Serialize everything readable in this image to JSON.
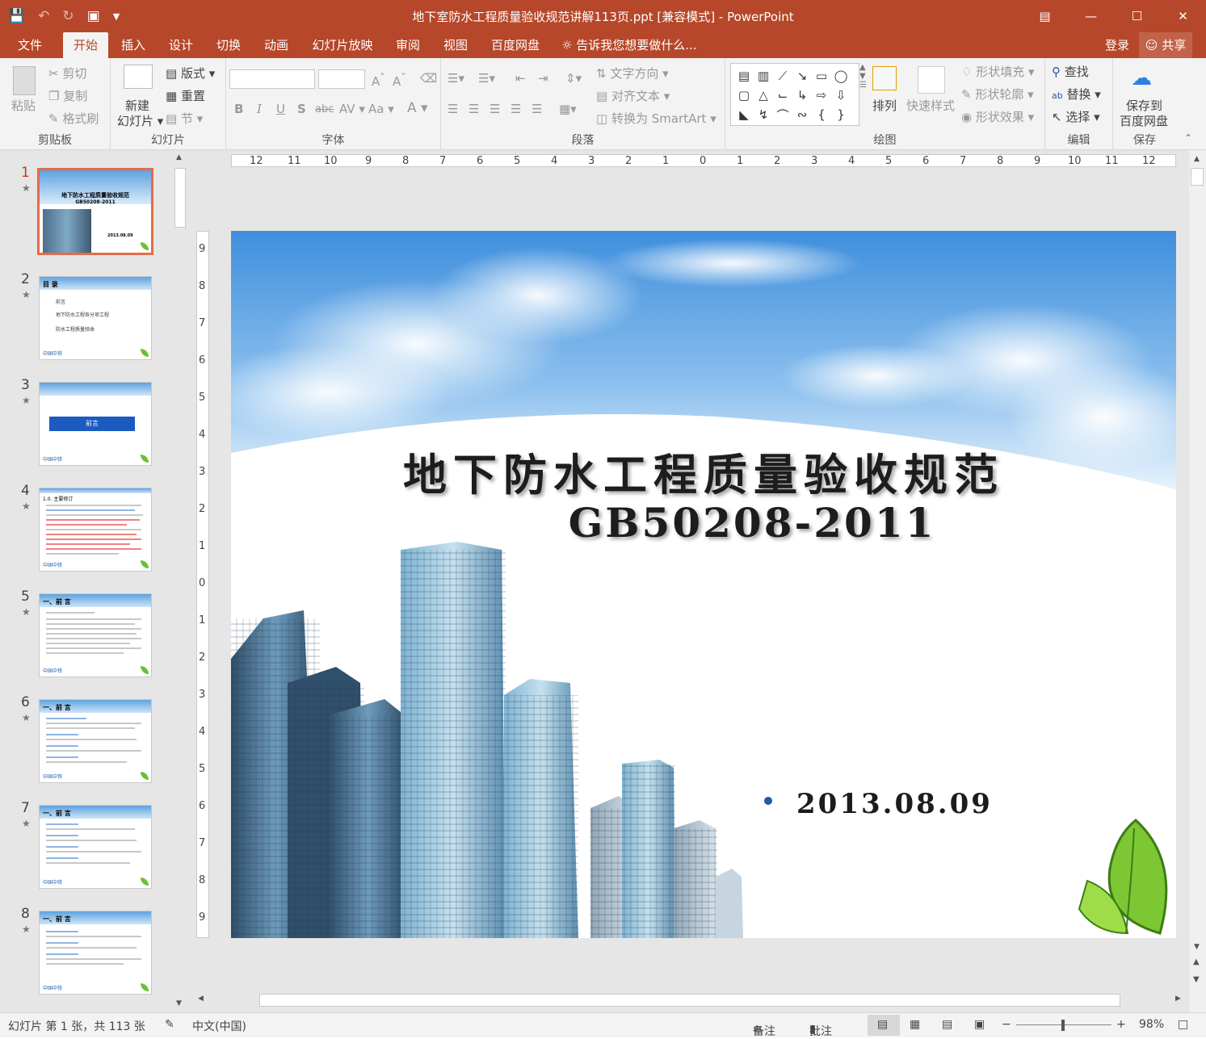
{
  "window": {
    "title": "地下室防水工程质量验收规范讲解113页.ppt [兼容模式] - PowerPoint",
    "accent": "#b7472a",
    "qat_icons": [
      "save-icon",
      "undo-icon",
      "redo-icon",
      "present-icon",
      "customize-icon"
    ]
  },
  "tabs": [
    {
      "label": "文件"
    },
    {
      "label": "开始"
    },
    {
      "label": "插入"
    },
    {
      "label": "设计"
    },
    {
      "label": "切换"
    },
    {
      "label": "动画"
    },
    {
      "label": "幻灯片放映"
    },
    {
      "label": "审阅"
    },
    {
      "label": "视图"
    },
    {
      "label": "百度网盘"
    }
  ],
  "tell_me": "告诉我您想要做什么...",
  "account": {
    "login": "登录",
    "share": "共享"
  },
  "ribbon": {
    "clipboard": {
      "label": "剪贴板",
      "paste": "粘贴",
      "cut": "剪切",
      "copy": "复制",
      "format_painter": "格式刷"
    },
    "slides": {
      "label": "幻灯片",
      "new_slide_1": "新建",
      "new_slide_2": "幻灯片",
      "layout": "版式",
      "reset": "重置",
      "section": "节"
    },
    "font": {
      "label": "字体",
      "font_name": "",
      "font_size": "",
      "bold": "B",
      "italic": "I",
      "underline": "U",
      "shadow": "S",
      "strike": "abc",
      "spacing": "AV",
      "case": "Aa",
      "grow": "A",
      "shrink": "A",
      "color": "A"
    },
    "paragraph": {
      "label": "段落",
      "text_direction": "文字方向",
      "align_text": "对齐文本",
      "smartart": "转换为 SmartArt"
    },
    "drawing": {
      "label": "绘图",
      "arrange": "排列",
      "quick_styles": "快速样式",
      "shape_fill": "形状填充",
      "shape_outline": "形状轮廓",
      "shape_effects": "形状效果"
    },
    "editing": {
      "label": "编辑",
      "find": "查找",
      "replace": "替换",
      "select": "选择"
    },
    "save": {
      "label": "保存",
      "save_to_1": "保存到",
      "save_to_2": "百度网盘"
    }
  },
  "thumbnails": [
    {
      "num": "1",
      "title": "地下防水工程质量验收规范",
      "code": "GB50208-2011",
      "date": "2013.08.09"
    },
    {
      "num": "2",
      "header": "目 录",
      "items": [
        "前言",
        "地下防水工程各分项工程",
        "防水工程质量验收"
      ],
      "footer": "中国中铁"
    },
    {
      "num": "3",
      "button": "前言",
      "footer": "中国中铁"
    },
    {
      "num": "4",
      "header": "1.0. 主要修订",
      "footer": "中国中铁"
    },
    {
      "num": "5",
      "header": "一、前 言",
      "footer": "中国中铁"
    },
    {
      "num": "6",
      "header": "一、前 言",
      "footer": "中国中铁"
    },
    {
      "num": "7",
      "header": "一、前 言",
      "footer": "中国中铁"
    },
    {
      "num": "8",
      "header": "一、前 言",
      "footer": "中国中铁"
    }
  ],
  "ruler": {
    "h": [
      "12",
      "11",
      "10",
      "9",
      "8",
      "7",
      "6",
      "5",
      "4",
      "3",
      "2",
      "1",
      "0",
      "1",
      "2",
      "3",
      "4",
      "5",
      "6",
      "7",
      "8",
      "9",
      "10",
      "11",
      "12"
    ],
    "v": [
      "9",
      "8",
      "7",
      "6",
      "5",
      "4",
      "3",
      "2",
      "1",
      "0",
      "1",
      "2",
      "3",
      "4",
      "5",
      "6",
      "7",
      "8",
      "9"
    ]
  },
  "slide": {
    "title": "地下防水工程质量验收规范",
    "code": "GB50208-2011",
    "date": "2013.08.09"
  },
  "status": {
    "slide_info": "幻灯片 第 1 张，共 113 张",
    "language": "中文(中国)",
    "notes": "备注",
    "comments": "批注",
    "zoom": "98%",
    "zoom_percent": 98
  }
}
